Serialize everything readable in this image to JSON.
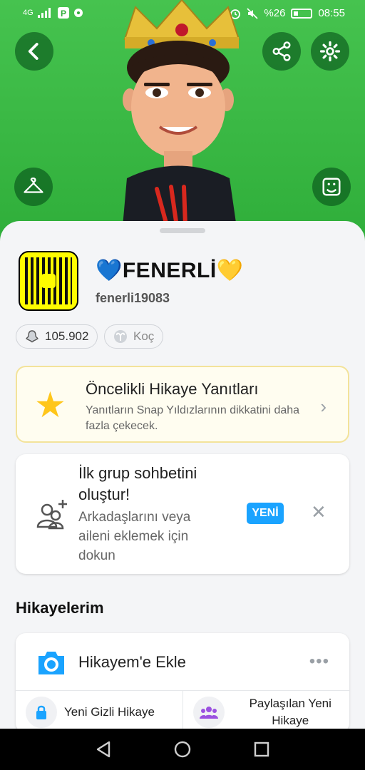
{
  "status_bar": {
    "network": "4G",
    "battery": "%26",
    "time": "08:55"
  },
  "profile": {
    "display_name": "💙FENERLİ💛",
    "username": "fenerli19083",
    "snap_score": "105.902",
    "zodiac": "Koç"
  },
  "priority_card": {
    "title": "Öncelikli Hikaye Yanıtları",
    "description": "Yanıtların Snap Yıldızlarının dikkatini daha fazla çekecek."
  },
  "group_card": {
    "title": "İlk grup sohbetini oluştur!",
    "description": "Arkadaşlarını veya aileni eklemek için dokun",
    "badge": "YENİ"
  },
  "stories": {
    "section_title": "Hikayelerim",
    "add_label": "Hikayem'e Ekle",
    "private_label": "Yeni Gizli Hikaye",
    "shared_label": "Paylaşılan Yeni Hikaye"
  },
  "colors": {
    "hero_green": "#3cbc45",
    "snap_yellow": "#fffc00",
    "accent_blue": "#1aa3ff",
    "star_yellow": "#ffc61a"
  }
}
